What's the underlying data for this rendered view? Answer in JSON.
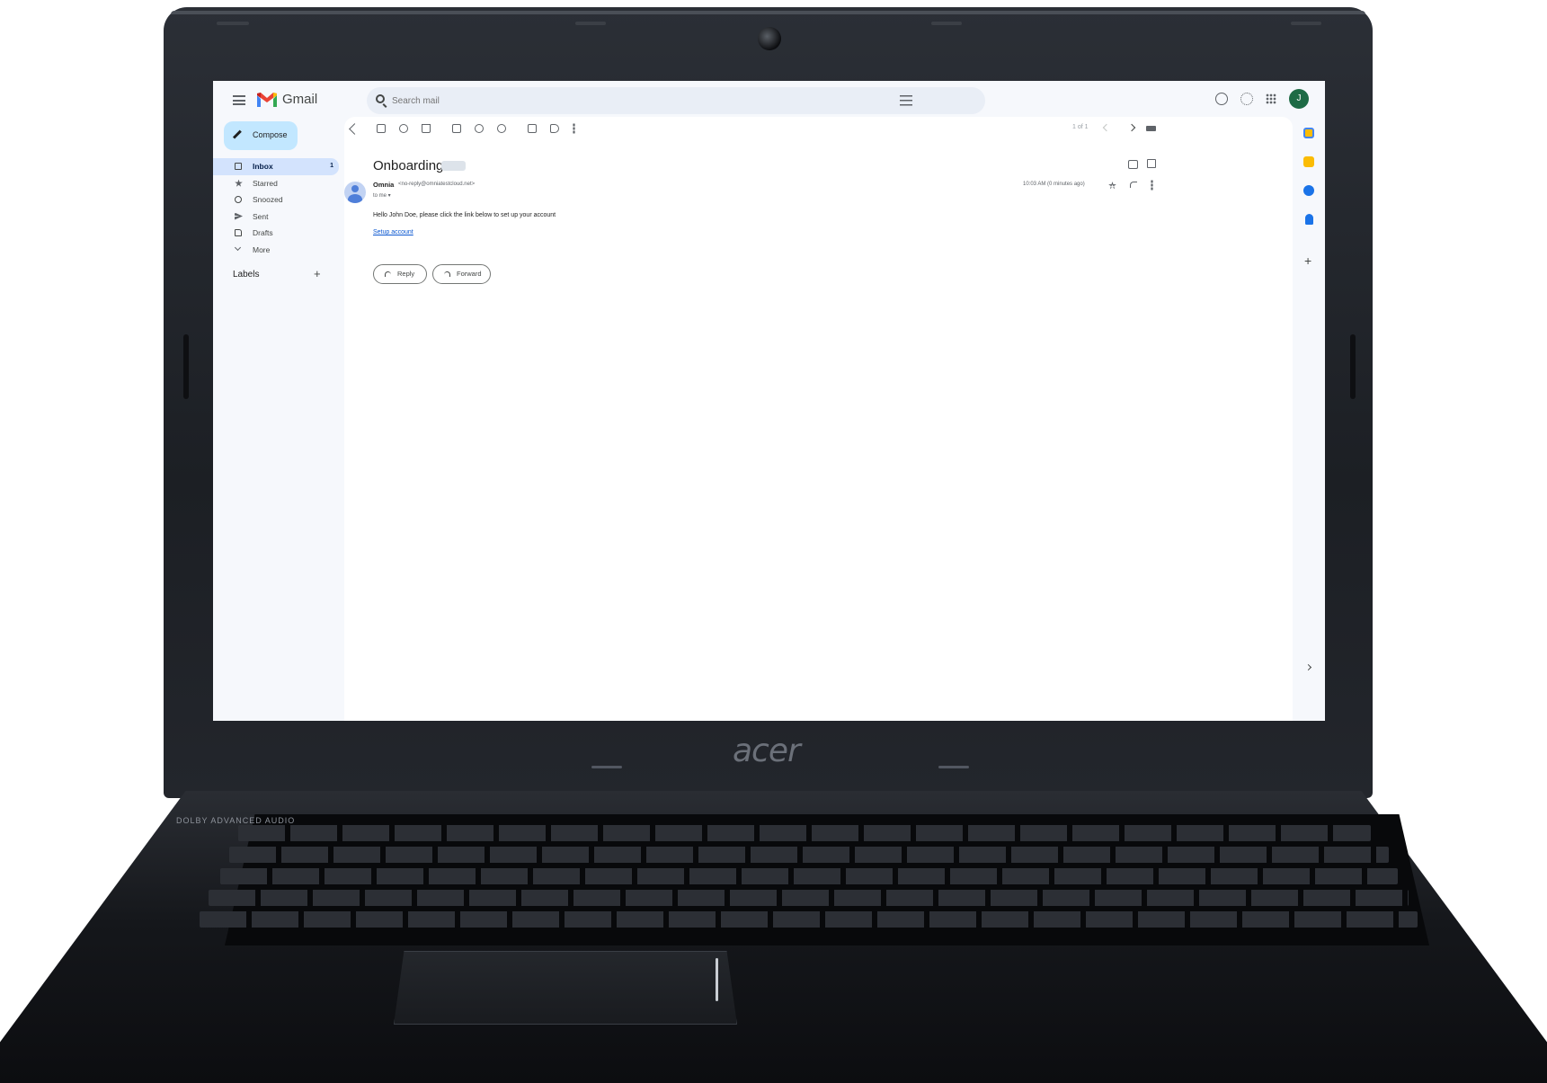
{
  "app": {
    "name": "Gmail",
    "brand_colors": {
      "accent": "#0b57d0",
      "compose_bg": "#c2e7ff",
      "active_nav": "#d3e3fd",
      "avatar_bg": "#1e6b45"
    }
  },
  "laptop": {
    "brand": "acer",
    "audio_badge": "DOLBY ADVANCED AUDIO"
  },
  "search": {
    "placeholder": "Search mail"
  },
  "header": {
    "avatar_initial": "J"
  },
  "sidebar": {
    "compose_label": "Compose",
    "items": [
      {
        "label": "Inbox",
        "count": "1",
        "icon": "inbox-icon",
        "active": true
      },
      {
        "label": "Starred",
        "icon": "star-icon"
      },
      {
        "label": "Snoozed",
        "icon": "clock-icon"
      },
      {
        "label": "Sent",
        "icon": "send-icon"
      },
      {
        "label": "Drafts",
        "icon": "draft-icon"
      },
      {
        "label": "More",
        "icon": "chevron-down-icon"
      }
    ],
    "labels_heading": "Labels",
    "labels_add": "+"
  },
  "toolbar": {
    "pager": "1 of 1"
  },
  "email": {
    "subject": "Onboarding",
    "sender_name": "Omnia",
    "sender_email": "<no-reply@omniatestcloud.net>",
    "to_line": "to me ▾",
    "timestamp": "10:03 AM (0 minutes ago)",
    "body": "Hello John Doe, please click the link below to set up your account",
    "link_text": "Setup account",
    "reply_label": "Reply",
    "forward_label": "Forward"
  },
  "side_panel": {
    "add": "+"
  }
}
